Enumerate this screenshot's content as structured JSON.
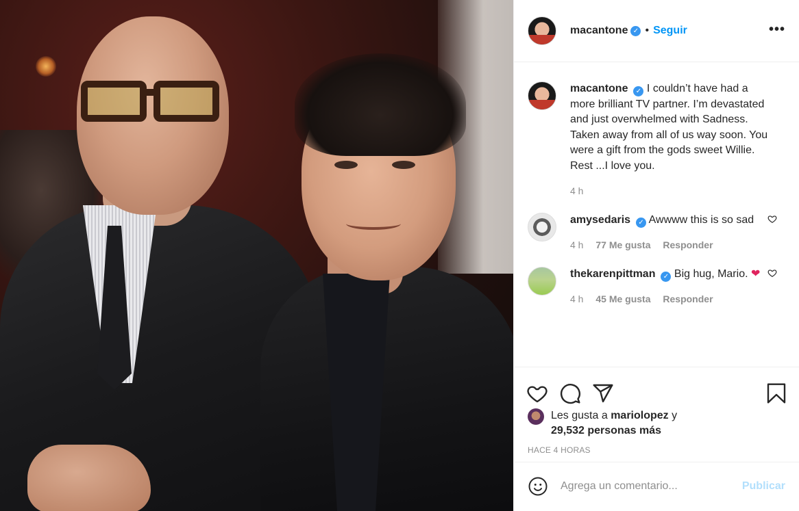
{
  "post": {
    "author": "macantone",
    "follow_label": "Seguir",
    "separator": "•",
    "more_label": "•••",
    "verified_mark": "✓"
  },
  "comments": [
    {
      "user": "macantone",
      "text": "I couldn’t have had a more brilliant TV partner. I’m devastated and just overwhelmed with Sadness. Taken away from all of us way soon. You were a gift from the gods sweet Willie. Rest ...I love you.",
      "time": "4 h"
    },
    {
      "user": "amysedaris",
      "text": "Awwww this is so sad",
      "time": "4 h",
      "likes": "77 Me gusta",
      "reply_label": "Responder"
    },
    {
      "user": "thekarenpittman",
      "text": "Big hug, Mario.",
      "emoji": "❤",
      "time": "4 h",
      "likes": "45 Me gusta",
      "reply_label": "Responder"
    }
  ],
  "likes": {
    "prefix": "Les gusta a",
    "user": "mariolopez",
    "conj": "y",
    "others": "29,532 personas más"
  },
  "posted_ago": "HACE 4 HORAS",
  "comment_box": {
    "placeholder": "Agrega un comentario...",
    "publish_label": "Publicar"
  },
  "colors": {
    "accent": "#0095f6",
    "verified": "#3897f0",
    "muted": "#8e8e8e",
    "publish_disabled": "#b2dffc",
    "heart_red": "#e0245e"
  },
  "icons": [
    "like-icon",
    "comment-icon",
    "share-icon",
    "bookmark-icon",
    "emoji-icon",
    "heart-outline-icon",
    "verified-badge-icon",
    "more-options-icon"
  ]
}
